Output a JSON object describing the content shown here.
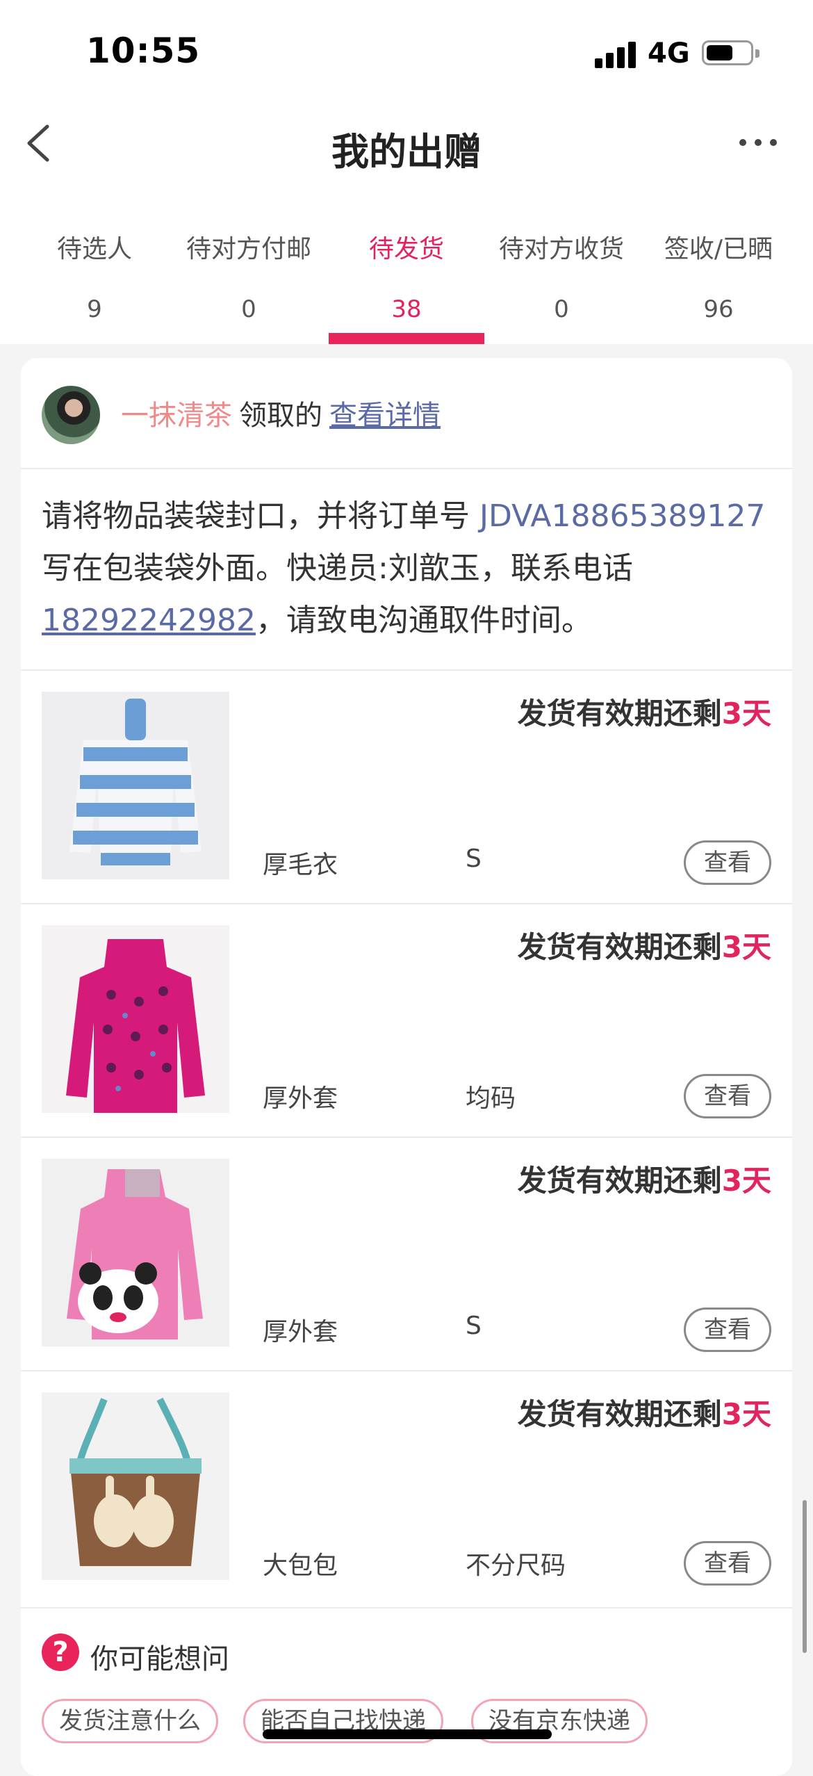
{
  "status_bar": {
    "time": "10:55",
    "network": "4G",
    "battery_level": 0.6
  },
  "nav": {
    "title": "我的出赠",
    "back_icon": "chevron-left-icon",
    "more_icon": "more-horizontal-icon"
  },
  "tabs": [
    {
      "label": "待选人",
      "count": "9",
      "active": false
    },
    {
      "label": "待对方付邮",
      "count": "0",
      "active": false
    },
    {
      "label": "待发货",
      "count": "38",
      "active": true
    },
    {
      "label": "待对方收货",
      "count": "0",
      "active": false
    },
    {
      "label": "签收/已晒",
      "count": "96",
      "active": false
    }
  ],
  "order": {
    "donor_name": "一抹清茶",
    "action_text": "领取的",
    "detail_link": "查看详情",
    "instruction_prefix": "请将物品装袋封口，并将订单号 ",
    "order_number": "JDVA18865389127",
    "instruction_middle": " 写在包装袋外面。快递员:刘歆玉，联系电话",
    "phone": "18292242982",
    "instruction_suffix": "，请致电沟通取件时间。"
  },
  "items": [
    {
      "deadline_prefix": "发货有效期还剩",
      "deadline_days": "3天",
      "name": "厚毛衣",
      "size": "S",
      "view_label": "查看",
      "image": "blue-white-striped-sweater"
    },
    {
      "deadline_prefix": "发货有效期还剩",
      "deadline_days": "3天",
      "name": "厚外套",
      "size": "均码",
      "view_label": "查看",
      "image": "magenta-patterned-hoodie"
    },
    {
      "deadline_prefix": "发货有效期还剩",
      "deadline_days": "3天",
      "name": "厚外套",
      "size": "S",
      "view_label": "查看",
      "image": "pink-panda-hoodie"
    },
    {
      "deadline_prefix": "发货有效期还剩",
      "deadline_days": "3天",
      "name": "大包包",
      "size": "不分尺码",
      "view_label": "查看",
      "image": "brown-bunny-tote-bag"
    }
  ],
  "faq": {
    "title": "你可能想问",
    "icon": "question-icon",
    "chips": [
      "发货注意什么",
      "能否自己找快递",
      "没有京东快递"
    ]
  },
  "colors": {
    "accent": "#e8245a",
    "link": "#5a6aa5",
    "donor_name": "#ee8a8a"
  }
}
